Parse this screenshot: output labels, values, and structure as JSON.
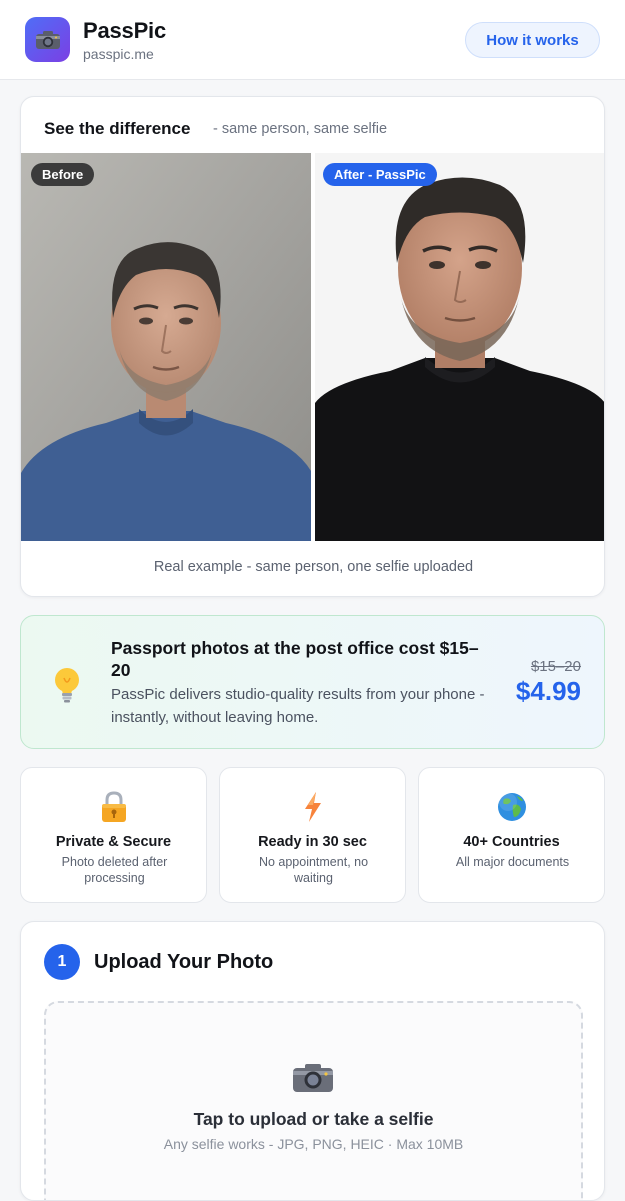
{
  "header": {
    "brand_name": "PassPic",
    "brand_domain": "passpic.me",
    "logo_icon": "camera-icon",
    "how_it_works": "How it works"
  },
  "comparison": {
    "title": "See the difference",
    "subtitle": "- same person, same selfie",
    "before_label": "Before",
    "after_label": "After - PassPic",
    "caption": "Real example - same person, one selfie uploaded"
  },
  "promo": {
    "icon": "lightbulb-icon",
    "title": "Passport photos at the post office cost $15–20",
    "body": "PassPic delivers studio-quality results from your phone - instantly, without leaving home.",
    "old_price": "$15–20",
    "new_price": "$4.99"
  },
  "features": [
    {
      "icon": "lock-icon",
      "title": "Private & Secure",
      "desc": "Photo deleted after processing"
    },
    {
      "icon": "lightning-icon",
      "title": "Ready in 30 sec",
      "desc": "No appointment, no waiting"
    },
    {
      "icon": "globe-icon",
      "title": "40+ Countries",
      "desc": "All major documents"
    }
  ],
  "upload": {
    "step_number": "1",
    "title": "Upload Your Photo",
    "icon": "camera-icon",
    "drop_title": "Tap to upload or take a selfie",
    "drop_subtitle": "Any selfie works - JPG, PNG, HEIC · Max 10MB"
  },
  "colors": {
    "accent": "#2563eb",
    "logo_gradient_start": "#4f6ef7",
    "logo_gradient_end": "#7b3fe4",
    "promo_border": "#bfe7cf"
  }
}
